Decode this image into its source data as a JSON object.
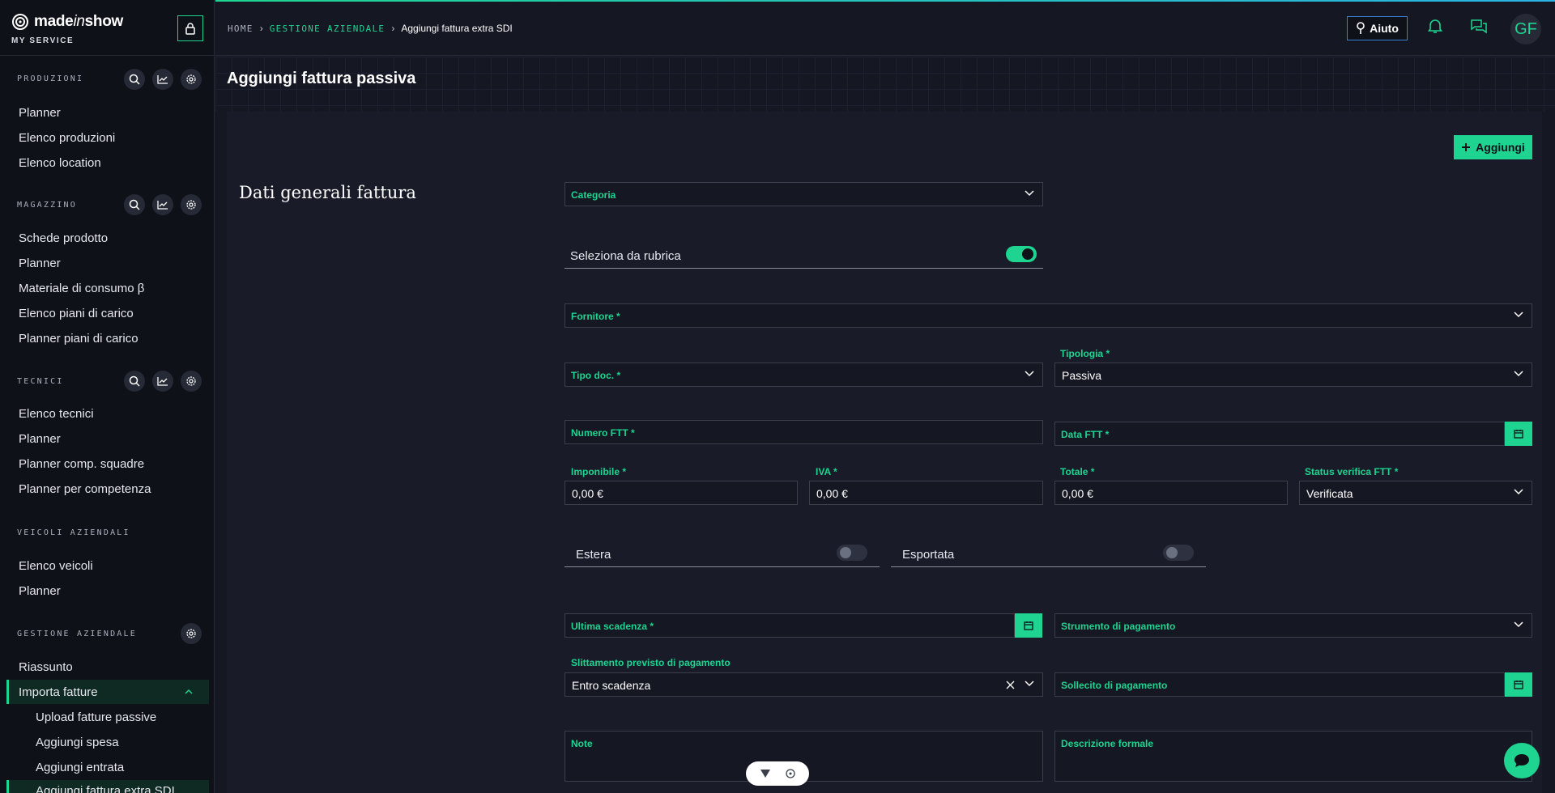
{
  "brand": {
    "name_pre": "made",
    "name_italic": "in",
    "name_post": "show",
    "subtitle": "MY SERVICE"
  },
  "sidebar": {
    "sections": [
      {
        "title": "PRODUZIONI",
        "items": [
          "Planner",
          "Elenco produzioni",
          "Elenco location"
        ]
      },
      {
        "title": "MAGAZZINO",
        "items": [
          "Schede prodotto",
          "Planner",
          "Materiale di consumo β",
          "Elenco piani di carico",
          "Planner piani di carico"
        ]
      },
      {
        "title": "TECNICI",
        "items": [
          "Elenco tecnici",
          "Planner",
          "Planner comp. squadre",
          "Planner per competenza"
        ]
      },
      {
        "title": "VEICOLI AZIENDALI",
        "items": [
          "Elenco veicoli",
          "Planner"
        ]
      },
      {
        "title": "GESTIONE AZIENDALE",
        "items": [
          "Riassunto",
          "Importa fatture"
        ],
        "subitems": [
          "Upload fatture passive",
          "Aggiungi spesa",
          "Aggiungi entrata",
          "Aggiungi fattura extra SDI"
        ]
      }
    ]
  },
  "breadcrumb": {
    "home": "HOME",
    "section": "GESTIONE AZIENDALE",
    "current": "Aggiungi fattura extra SDI"
  },
  "topbar": {
    "help_label": "Aiuto",
    "avatar_initials": "GF"
  },
  "page": {
    "title": "Aggiungi fattura passiva",
    "add_label": "Aggiungi",
    "section_title": "Dati generali fattura"
  },
  "form": {
    "categoria": "Categoria",
    "rubrica": "Seleziona da rubrica",
    "rubrica_on": true,
    "fornitore": "Fornitore *",
    "tipo_doc": "Tipo doc. *",
    "tipologia_label": "Tipologia *",
    "tipologia_value": "Passiva",
    "numero_ftt": "Numero FTT *",
    "data_ftt": "Data FTT *",
    "imponibile_label": "Imponibile *",
    "imponibile_value": "0,00 €",
    "iva_label": "IVA *",
    "iva_value": "0,00 €",
    "totale_label": "Totale *",
    "totale_value": "0,00 €",
    "status_label": "Status verifica FTT *",
    "status_value": "Verificata",
    "estera": "Estera",
    "esportata": "Esportata",
    "ultima_scadenza": "Ultima scadenza *",
    "strumento": "Strumento di pagamento",
    "slittamento_label": "Slittamento previsto di pagamento",
    "slittamento_value": "Entro scadenza",
    "sollecito": "Sollecito di pagamento",
    "note": "Note",
    "descrizione": "Descrizione formale"
  },
  "colors": {
    "accent": "#1ed490",
    "background": "#151823",
    "sidebar": "#0f1119",
    "help_border": "#3a7fd6"
  }
}
